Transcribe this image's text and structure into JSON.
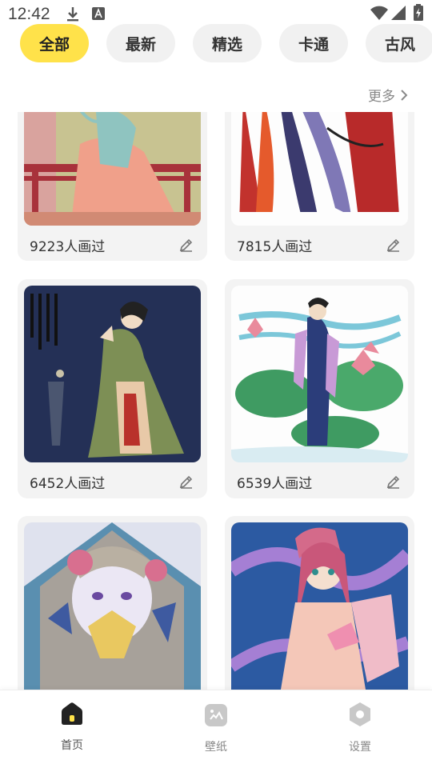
{
  "status_bar": {
    "time": "12:42",
    "icons": [
      "download-icon",
      "a-notification-icon",
      "wifi-icon",
      "signal-icon",
      "battery-icon"
    ]
  },
  "categories": [
    {
      "label": "全部",
      "active": true
    },
    {
      "label": "最新",
      "active": false
    },
    {
      "label": "精选",
      "active": false
    },
    {
      "label": "卡通",
      "active": false
    },
    {
      "label": "古风",
      "active": false
    }
  ],
  "more_label": "更多",
  "cards": [
    {
      "count": "9223人画过"
    },
    {
      "count": "7815人画过"
    },
    {
      "count": "6452人画过"
    },
    {
      "count": "6539人画过"
    },
    {
      "count": ""
    },
    {
      "count": ""
    }
  ],
  "bottom_nav": [
    {
      "label": "首页",
      "icon": "home-icon",
      "active": true
    },
    {
      "label": "壁纸",
      "icon": "wallpaper-icon",
      "active": false
    },
    {
      "label": "设置",
      "icon": "settings-icon",
      "active": false
    }
  ],
  "colors": {
    "accent": "#ffe24a",
    "tab_bg": "#f1f1f1",
    "card_bg": "#f3f3f3"
  }
}
